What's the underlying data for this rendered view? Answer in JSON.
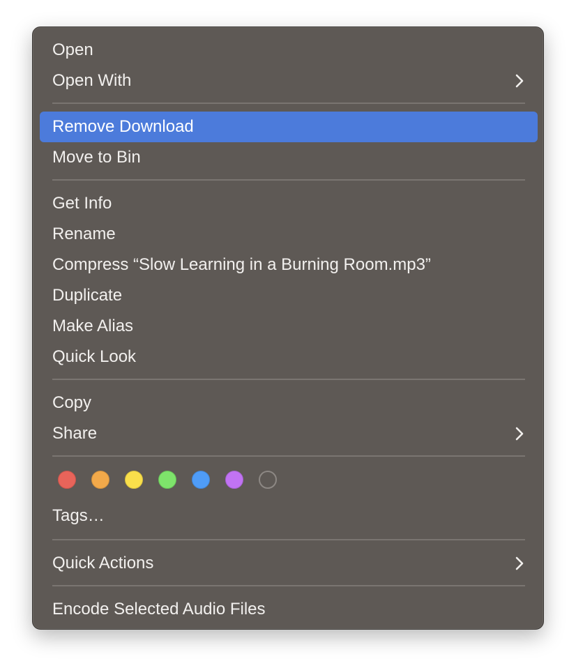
{
  "menu": {
    "items": [
      {
        "label": "Open"
      },
      {
        "label": "Open With"
      },
      {
        "label": "Remove Download"
      },
      {
        "label": "Move to Bin"
      },
      {
        "label": "Get Info"
      },
      {
        "label": "Rename"
      },
      {
        "label": "Compress “Slow Learning in a Burning Room.mp3”"
      },
      {
        "label": "Duplicate"
      },
      {
        "label": "Make Alias"
      },
      {
        "label": "Quick Look"
      },
      {
        "label": "Copy"
      },
      {
        "label": "Share"
      },
      {
        "label": "Tags…"
      },
      {
        "label": "Quick Actions"
      },
      {
        "label": "Encode Selected Audio Files"
      }
    ],
    "highlighted_item": "Remove Download",
    "submenu_icon": "chevron-right-icon",
    "tag_colors": [
      {
        "name": "red",
        "color": "#e8645a"
      },
      {
        "name": "orange",
        "color": "#f2a94a"
      },
      {
        "name": "yellow",
        "color": "#f9df4b"
      },
      {
        "name": "green",
        "color": "#7ee36b"
      },
      {
        "name": "blue",
        "color": "#4f9cf7"
      },
      {
        "name": "purple",
        "color": "#c173f3"
      },
      {
        "name": "gray",
        "color": "transparent"
      }
    ],
    "highlight_color": "#4c7bdb",
    "background_color": "#5e5955"
  }
}
